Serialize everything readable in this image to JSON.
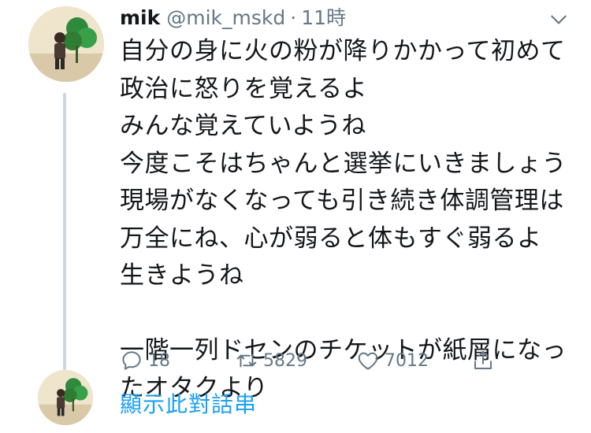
{
  "tweet": {
    "display_name": "mik",
    "handle": "@mik_mskd",
    "separator": "·",
    "time": "11時",
    "text": "自分の身に火の粉が降りかかって初めて\n政治に怒りを覚えるよ\nみんな覚えていようね\n今度こそはちゃんと選挙にいきましょう\n現場がなくなっても引き続き体調管理は\n万全にね、心が弱ると体もすぐ弱るよ\n生きようね\n\n一階一列ドセンのチケットが紙屑になっ\nたオタクより"
  },
  "actions": {
    "reply_count": "18",
    "retweet_count": "5829",
    "like_count": "7012"
  },
  "thread_link": "顯示此對話串",
  "icons": {
    "reply": "reply-icon",
    "retweet": "retweet-icon",
    "like": "heart-icon",
    "share": "share-icon",
    "menu": "chevron-down-icon"
  },
  "colors": {
    "text": "#14171a",
    "muted": "#657786",
    "link": "#1da1f2",
    "thread_line": "#ccd6dd"
  }
}
